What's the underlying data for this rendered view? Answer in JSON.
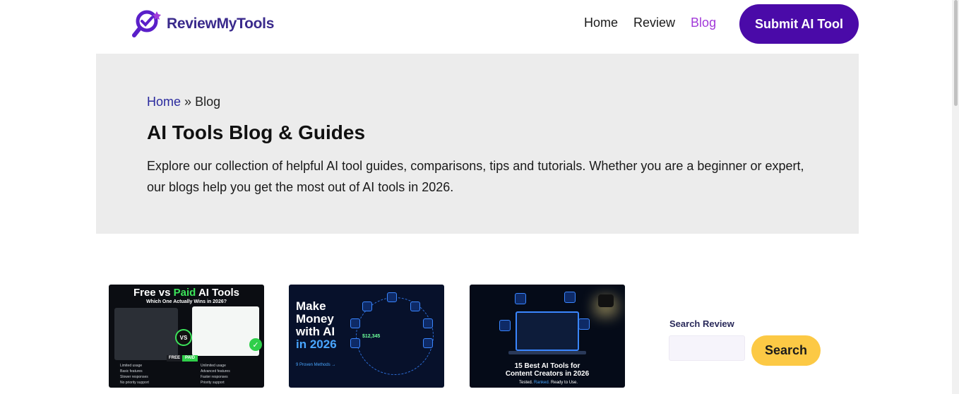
{
  "header": {
    "logo_text": "ReviewMyTools",
    "nav": [
      {
        "label": "Home",
        "active": false
      },
      {
        "label": "Review",
        "active": false
      },
      {
        "label": "Blog",
        "active": true
      }
    ],
    "submit_label": "Submit AI Tool"
  },
  "hero": {
    "breadcrumb_home": "Home",
    "breadcrumb_sep": "»",
    "breadcrumb_current": "Blog",
    "title": "AI Tools Blog & Guides",
    "description": "Explore our collection of helpful AI tool guides, comparisons, tips and tutorials. Whether you are a beginner or expert, our blogs help you get the most out of AI tools in 2026."
  },
  "cards": [
    {
      "title_pre": "Free vs ",
      "title_hl": "Paid",
      "title_post": " AI Tools",
      "subtitle": "Which One Actually Wins in 2026?",
      "vs": "VS",
      "tag_free": "FREE",
      "tag_paid": "PAID",
      "free_list": [
        "Limited usage",
        "Basic features",
        "Slower responses",
        "No priority support"
      ],
      "paid_list": [
        "Unlimited usage",
        "Advanced features",
        "Faster responses",
        "Priority support"
      ]
    },
    {
      "title_lines": [
        "Make",
        "Money",
        "with AI"
      ],
      "title_year": "in 2026",
      "link": "9 Proven Methods →",
      "money": "$12,345"
    },
    {
      "title_lines": [
        "15 Best AI Tools for",
        "Content Creators in 2026"
      ],
      "tag_pre": "Tested. ",
      "tag_hl": "Ranked.",
      "tag_post": " Ready to Use."
    }
  ],
  "search": {
    "label": "Search Review",
    "placeholder": "",
    "button_label": "Search"
  },
  "colors": {
    "brand": "#4a0aa8",
    "nav_active": "#a23ad9",
    "search_button": "#fcc945",
    "hero_bg": "#ececec"
  }
}
